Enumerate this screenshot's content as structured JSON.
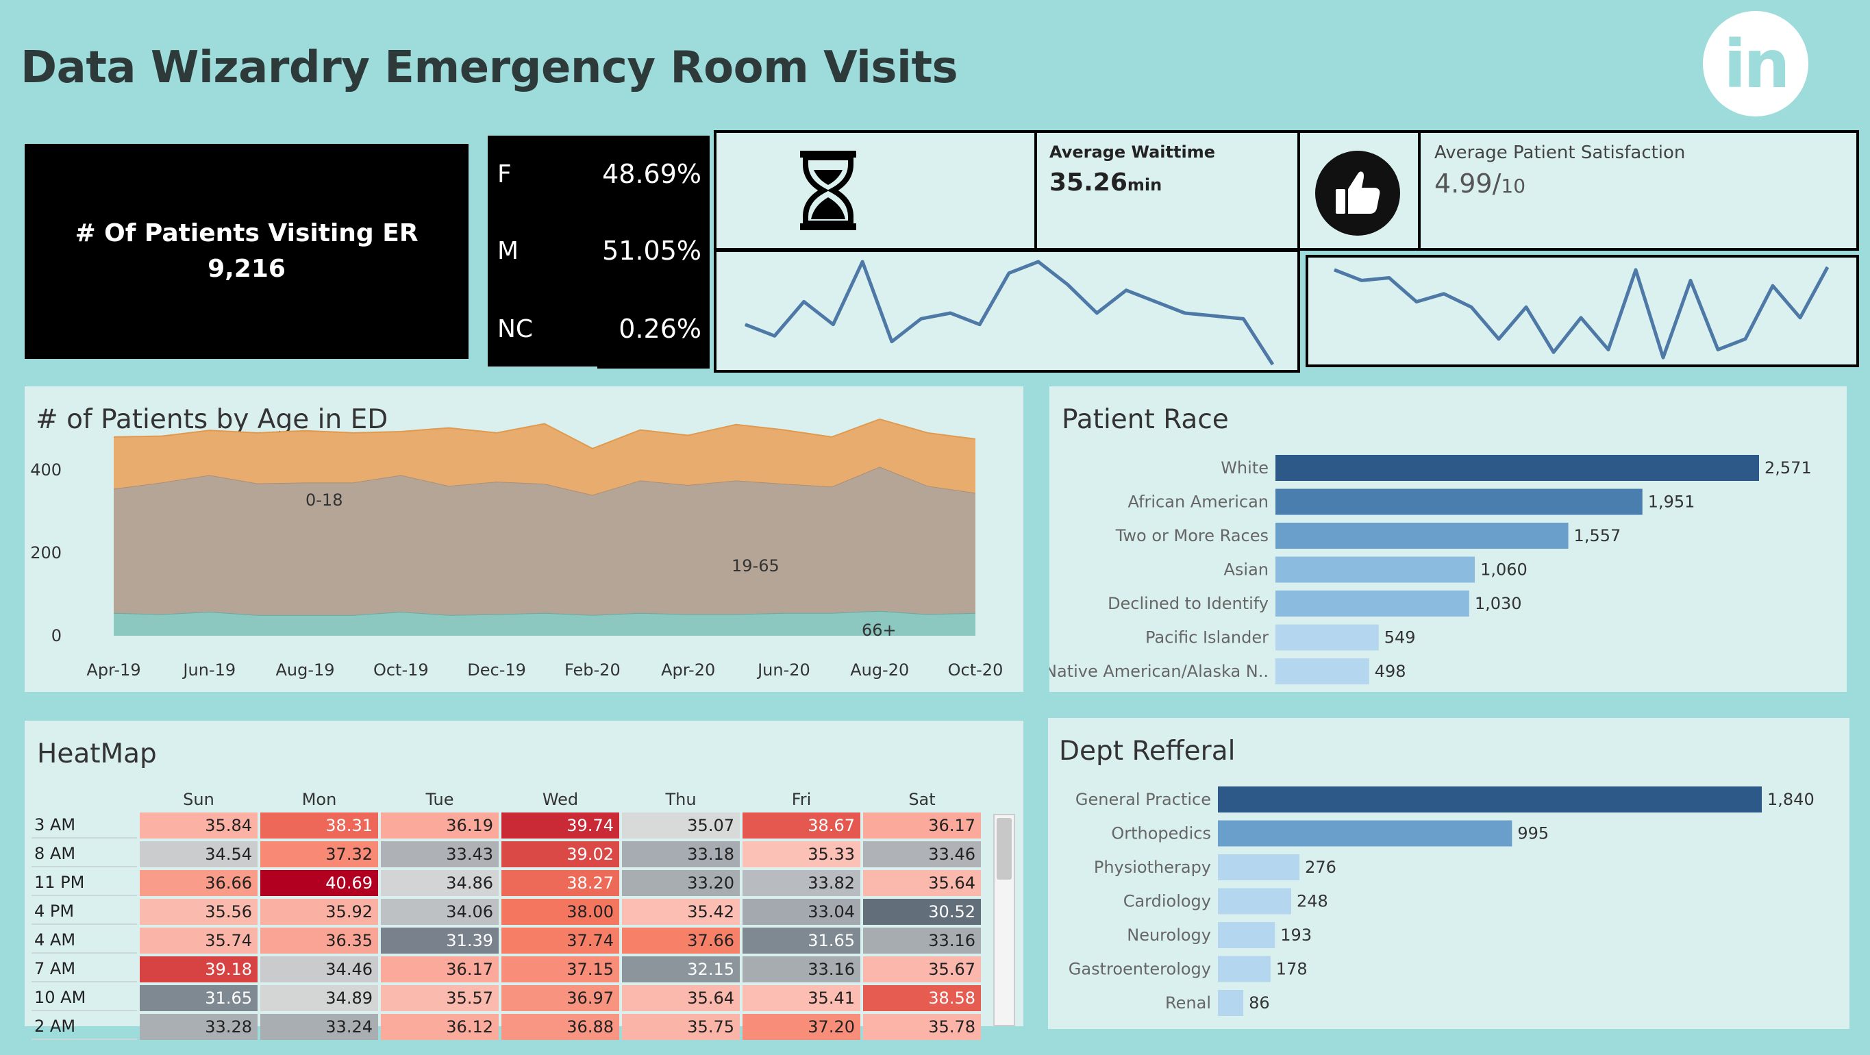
{
  "title": "Data Wizardry Emergency Room Visits",
  "logo": {
    "icon": "linkedin-logo",
    "text": "in"
  },
  "patients_kpi": {
    "label": "# Of Patients Visiting ER",
    "value": "9,216"
  },
  "gender": [
    {
      "key": "F",
      "value": "48.69%"
    },
    {
      "key": "M",
      "value": "51.05%"
    },
    {
      "key": "NC",
      "value": "0.26%"
    }
  ],
  "waittime": {
    "icon": "hourglass-icon",
    "label": "Average Waittime",
    "value": "35.26",
    "unit": "min"
  },
  "satisfaction": {
    "icon": "thumbs-up-icon",
    "label": "Average Patient Satisfaction",
    "value": "4.99/",
    "unit": "10"
  },
  "colors": {
    "background": "#9ddcdb",
    "panel": "#daf0ef",
    "line": "#4e79a7",
    "orange": "#e8ad6e",
    "brown": "#b4a596",
    "teal": "#8cc7c0"
  },
  "chart_data": [
    {
      "id": "waittime_trend",
      "type": "line",
      "values": [
        35.2,
        35.0,
        35.6,
        35.2,
        36.3,
        34.9,
        35.3,
        35.4,
        35.2,
        36.1,
        36.3,
        35.9,
        35.4,
        35.8,
        35.6,
        35.4,
        35.35,
        35.3,
        34.5
      ]
    },
    {
      "id": "satisfaction_trend",
      "type": "line",
      "values": [
        5.6,
        5.4,
        5.45,
        5.0,
        5.15,
        4.9,
        4.3,
        4.9,
        4.05,
        4.7,
        4.1,
        5.6,
        3.95,
        5.4,
        4.1,
        4.3,
        5.3,
        4.7,
        5.65
      ]
    },
    {
      "id": "age_area",
      "type": "area",
      "title": "# of Patients by Age in ED",
      "x": [
        "Apr-19",
        "May-19",
        "Jun-19",
        "Jul-19",
        "Aug-19",
        "Sep-19",
        "Oct-19",
        "Nov-19",
        "Dec-19",
        "Jan-20",
        "Feb-20",
        "Mar-20",
        "Apr-20",
        "May-20",
        "Jun-20",
        "Jul-20",
        "Aug-20",
        "Sep-20",
        "Oct-20"
      ],
      "x_tick_labels": [
        "Apr-19",
        "Jun-19",
        "Aug-19",
        "Oct-19",
        "Dec-19",
        "Feb-20",
        "Apr-20",
        "Jun-20",
        "Aug-20",
        "Oct-20"
      ],
      "y_ticks": [
        0,
        200,
        400
      ],
      "ylim": [
        0,
        520
      ],
      "series": [
        {
          "name": "66+",
          "values": [
            55,
            52,
            58,
            50,
            50,
            50,
            58,
            50,
            52,
            55,
            50,
            55,
            52,
            52,
            55,
            55,
            60,
            52,
            55
          ]
        },
        {
          "name": "19-65",
          "values": [
            300,
            318,
            330,
            318,
            320,
            320,
            330,
            312,
            320,
            312,
            290,
            320,
            312,
            323,
            312,
            305,
            348,
            310,
            290
          ]
        },
        {
          "name": "0-18",
          "values": [
            125,
            112,
            108,
            122,
            125,
            120,
            105,
            140,
            118,
            145,
            112,
            122,
            120,
            135,
            130,
            120,
            115,
            128,
            130
          ]
        }
      ],
      "series_labels": [
        "0-18",
        "19-65",
        "66+"
      ]
    },
    {
      "id": "patient_race",
      "type": "bar",
      "title": "Patient Race",
      "categories": [
        "White",
        "African American",
        "Two or More Races",
        "Asian",
        "Declined to Identify",
        "Pacific Islander",
        "Native American/Alaska N.."
      ],
      "values": [
        2571,
        1951,
        1557,
        1060,
        1030,
        549,
        498
      ],
      "value_labels": [
        "2,571",
        "1,951",
        "1,557",
        "1,060",
        "1,030",
        "549",
        "498"
      ],
      "colors": [
        "#2c5987",
        "#4a7eaf",
        "#6a9fcc",
        "#8cbbe0",
        "#8cbbe0",
        "#b4d6ee",
        "#b4d6ee"
      ]
    },
    {
      "id": "dept_referral",
      "type": "bar",
      "title": "Dept Refferal",
      "categories": [
        "General Practice",
        "Orthopedics",
        "Physiotherapy",
        "Cardiology",
        "Neurology",
        "Gastroenterology",
        "Renal"
      ],
      "values": [
        1840,
        995,
        276,
        248,
        193,
        178,
        86
      ],
      "value_labels": [
        "1,840",
        "995",
        "276",
        "248",
        "193",
        "178",
        "86"
      ],
      "colors": [
        "#2c5987",
        "#6a9fcc",
        "#b4d6ee",
        "#b4d6ee",
        "#b4d6ee",
        "#b4d6ee",
        "#b4d6ee"
      ]
    },
    {
      "id": "heatmap",
      "type": "heatmap",
      "title": "HeatMap",
      "columns": [
        "Sun",
        "Mon",
        "Tue",
        "Wed",
        "Thu",
        "Fri",
        "Sat"
      ],
      "rows": [
        {
          "label": "3 AM",
          "values": [
            "35.84",
            "38.31",
            "36.19",
            "39.74",
            "35.07",
            "38.67",
            "36.17"
          ]
        },
        {
          "label": "8 AM",
          "values": [
            "34.54",
            "37.32",
            "33.43",
            "39.02",
            "33.18",
            "35.33",
            "33.46"
          ]
        },
        {
          "label": "11 PM",
          "values": [
            "36.66",
            "40.69",
            "34.86",
            "38.27",
            "33.20",
            "33.82",
            "35.64"
          ]
        },
        {
          "label": "4 PM",
          "values": [
            "35.56",
            "35.92",
            "34.06",
            "38.00",
            "35.42",
            "33.04",
            "30.52"
          ]
        },
        {
          "label": "4 AM",
          "values": [
            "35.74",
            "36.35",
            "31.39",
            "37.74",
            "37.66",
            "31.65",
            "33.16"
          ]
        },
        {
          "label": "7 AM",
          "values": [
            "39.18",
            "34.46",
            "36.17",
            "37.15",
            "32.15",
            "33.16",
            "35.67"
          ]
        },
        {
          "label": "10 AM",
          "values": [
            "31.65",
            "34.89",
            "35.57",
            "36.97",
            "35.64",
            "35.41",
            "38.58"
          ]
        },
        {
          "label": "2 AM",
          "values": [
            "33.28",
            "33.24",
            "36.12",
            "36.88",
            "35.75",
            "37.20",
            "35.78"
          ]
        }
      ]
    }
  ]
}
